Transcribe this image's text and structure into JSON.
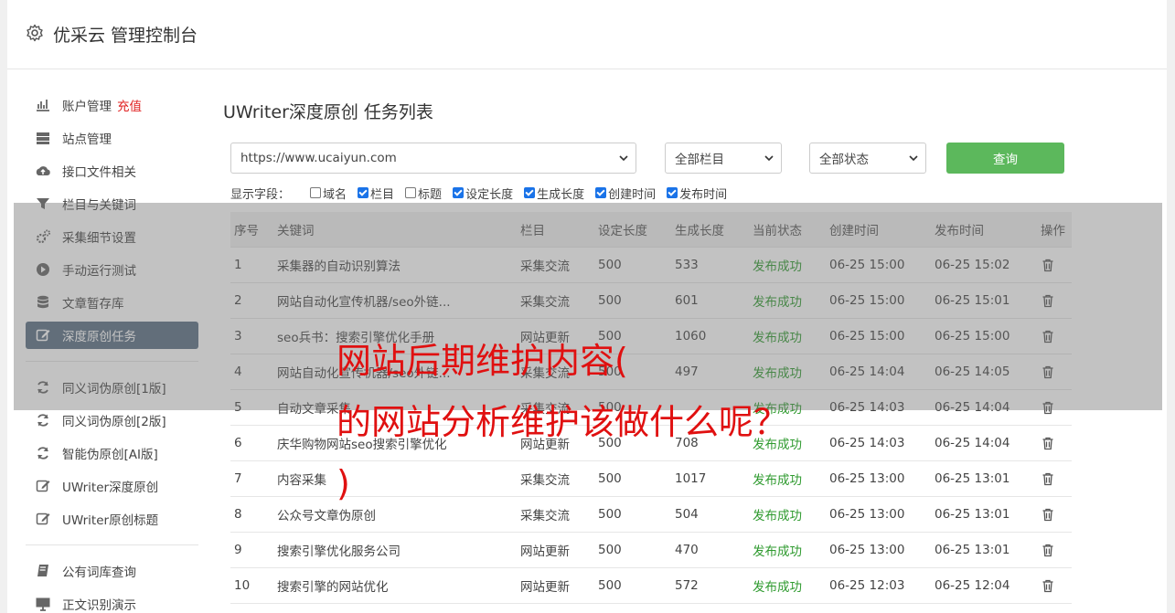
{
  "app": {
    "title": "优采云 管理控制台",
    "icon": "gear-icon"
  },
  "sidebar": {
    "items": [
      {
        "label": "账户管理",
        "tag": "充值",
        "icon": "bar-chart-icon"
      },
      {
        "label": "站点管理",
        "icon": "server-icon"
      },
      {
        "label": "接口文件相关",
        "icon": "cloud-upload-icon"
      },
      {
        "label": "栏目与关键词",
        "icon": "filter-icon"
      },
      {
        "label": "采集细节设置",
        "icon": "gears-icon"
      },
      {
        "label": "手动运行测试",
        "icon": "play-circle-icon"
      },
      {
        "label": "文章暂存库",
        "icon": "database-icon"
      },
      {
        "label": "深度原创任务",
        "icon": "edit-icon",
        "active": true
      },
      {
        "label": "同义词伪原创[1版]",
        "icon": "refresh-icon"
      },
      {
        "label": "同义词伪原创[2版]",
        "icon": "refresh-icon"
      },
      {
        "label": "智能伪原创[AI版]",
        "icon": "refresh-icon"
      },
      {
        "label": "UWriter深度原创",
        "icon": "edit-icon"
      },
      {
        "label": "UWriter原创标题",
        "icon": "edit-icon"
      },
      {
        "label": "公有词库查询",
        "icon": "book-icon"
      },
      {
        "label": "正文识别演示",
        "icon": "monitor-icon"
      }
    ]
  },
  "main": {
    "title": "UWriter深度原创 任务列表",
    "filters": {
      "site": "https://www.ucaiyun.com",
      "column": "全部栏目",
      "status": "全部状态",
      "query_label": "查询"
    },
    "fields": {
      "label": "显示字段：",
      "options": [
        {
          "label": "域名",
          "checked": false
        },
        {
          "label": "栏目",
          "checked": true
        },
        {
          "label": "标题",
          "checked": false
        },
        {
          "label": "设定长度",
          "checked": true
        },
        {
          "label": "生成长度",
          "checked": true
        },
        {
          "label": "创建时间",
          "checked": true
        },
        {
          "label": "发布时间",
          "checked": true
        }
      ]
    },
    "table": {
      "headers": [
        "序号",
        "关键词",
        "栏目",
        "设定长度",
        "生成长度",
        "当前状态",
        "创建时间",
        "发布时间",
        "操作"
      ],
      "rows": [
        [
          "1",
          "采集器的自动识别算法",
          "采集交流",
          "500",
          "533",
          "发布成功",
          "06-25 15:00",
          "06-25 15:02"
        ],
        [
          "2",
          "网站自动化宣传机器/seo外链...",
          "采集交流",
          "500",
          "601",
          "发布成功",
          "06-25 15:00",
          "06-25 15:01"
        ],
        [
          "3",
          "seo兵书：搜索引擎优化手册",
          "网站更新",
          "500",
          "1060",
          "发布成功",
          "06-25 15:00",
          "06-25 15:00"
        ],
        [
          "4",
          "网站自动化宣传机器/seo外链...",
          "采集交流",
          "500",
          "497",
          "发布成功",
          "06-25 14:04",
          "06-25 14:05"
        ],
        [
          "5",
          "自动文章采集",
          "采集交流",
          "500",
          "",
          "发布成功",
          "06-25 14:03",
          "06-25 14:04"
        ],
        [
          "6",
          "庆华购物网站seo搜索引擎优化",
          "网站更新",
          "500",
          "708",
          "发布成功",
          "06-25 14:03",
          "06-25 14:04"
        ],
        [
          "7",
          "内容采集",
          "采集交流",
          "500",
          "1017",
          "发布成功",
          "06-25 13:00",
          "06-25 13:01"
        ],
        [
          "8",
          "公众号文章伪原创",
          "采集交流",
          "500",
          "504",
          "发布成功",
          "06-25 13:00",
          "06-25 13:01"
        ],
        [
          "9",
          "搜索引擎优化服务公司",
          "网站更新",
          "500",
          "470",
          "发布成功",
          "06-25 13:00",
          "06-25 13:01"
        ],
        [
          "10",
          "搜索引擎的网站优化",
          "网站更新",
          "500",
          "572",
          "发布成功",
          "06-25 12:03",
          "06-25 12:04"
        ]
      ]
    }
  },
  "overlay": {
    "lines": [
      "网站后期维护内容(",
      "的网站分析维护该做什么呢？",
      ")"
    ],
    "color": "#e01010"
  }
}
